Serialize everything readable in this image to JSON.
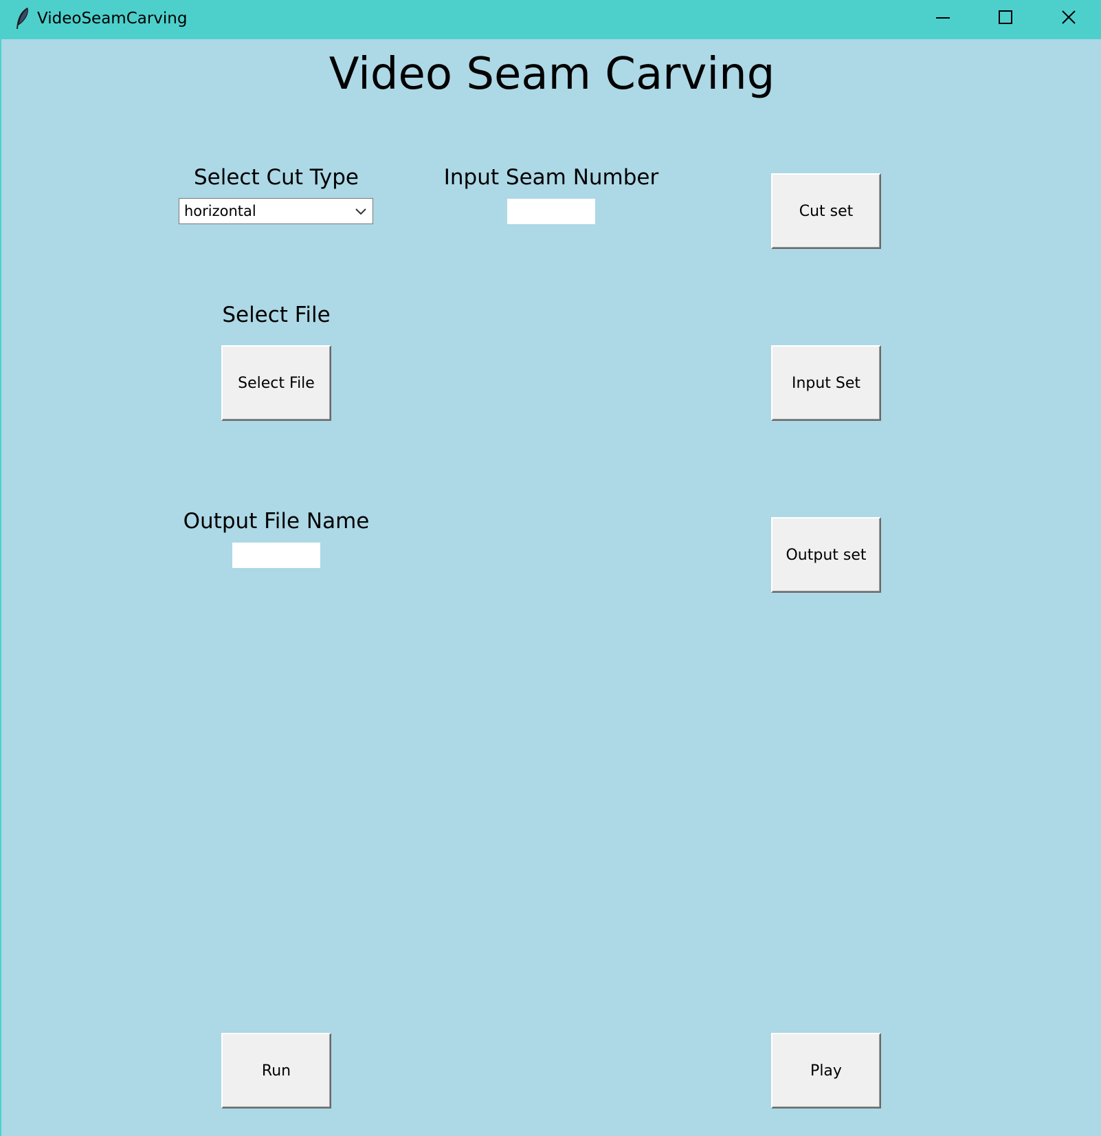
{
  "window": {
    "title": "VideoSeamCarving",
    "app_icon": "feather-icon",
    "controls": [
      "minimize-icon",
      "maximize-icon",
      "close-icon"
    ]
  },
  "heading": "Video Seam Carving",
  "cut_type": {
    "label": "Select Cut Type",
    "selected": "horizontal"
  },
  "seam_number": {
    "label": "Input Seam Number",
    "value": ""
  },
  "select_file": {
    "label": "Select File",
    "button_label": "Select File"
  },
  "output_name": {
    "label": "Output File Name",
    "value": ""
  },
  "buttons": {
    "cut_set": "Cut set",
    "input_set": "Input Set",
    "output_set": "Output set",
    "run": "Run",
    "play": "Play"
  },
  "colors": {
    "titlebar": "#4dd0cc",
    "client_background": "#add8e6",
    "button_face": "#f0f0f0"
  }
}
